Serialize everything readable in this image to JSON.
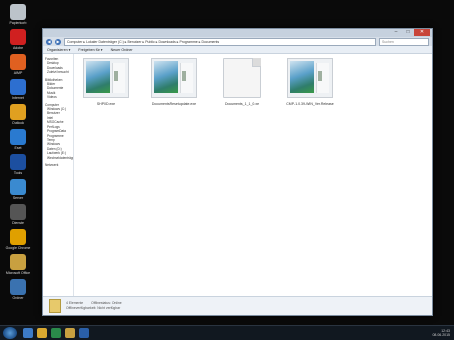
{
  "desktop": {
    "icons": [
      {
        "label": "Papierkorb",
        "color": "#bcc3ca"
      },
      {
        "label": "Adobe",
        "color": "#d02020"
      },
      {
        "label": "AIMP",
        "color": "#e06020"
      },
      {
        "label": "Internet",
        "color": "#2d6fd0"
      },
      {
        "label": "Outlook",
        "color": "#e0a020"
      },
      {
        "label": "Eset",
        "color": "#2a7ad0"
      },
      {
        "label": "Tools",
        "color": "#1c4fa0"
      },
      {
        "label": "Server",
        "color": "#3a8ad0"
      },
      {
        "label": "Dienste",
        "color": "#555555"
      },
      {
        "label": "Google Chrome",
        "color": "#e0a000"
      },
      {
        "label": "Microsoft Office",
        "color": "#c8a040"
      },
      {
        "label": "Ordner",
        "color": "#3a72b0"
      }
    ]
  },
  "window": {
    "address": "Computer ▸ Lokaler Datenträger (C:) ▸ Benutzer ▸ Public ▸ Downloads ▸ Programme ▸ Documents",
    "search_placeholder": "Suchen",
    "toolbar": {
      "organize": "Organisieren ▾",
      "share": "Freigeben für ▾",
      "new_folder": "Neuer Ordner"
    },
    "nav_items": [
      {
        "label": "Favoriten",
        "sub": false
      },
      {
        "label": "Desktop",
        "sub": true
      },
      {
        "label": "Downloads",
        "sub": true
      },
      {
        "label": "Zuletzt besucht",
        "sub": true
      },
      {
        "label": "",
        "gap": true
      },
      {
        "label": "Bibliotheken",
        "sub": false
      },
      {
        "label": "Bilder",
        "sub": true
      },
      {
        "label": "Dokumente",
        "sub": true
      },
      {
        "label": "Musik",
        "sub": true
      },
      {
        "label": "Videos",
        "sub": true
      },
      {
        "label": "",
        "gap": true
      },
      {
        "label": "Computer",
        "sub": false
      },
      {
        "label": "Windows (C:)",
        "sub": true
      },
      {
        "label": "Benutzer",
        "sub": true
      },
      {
        "label": "Intel",
        "sub": true
      },
      {
        "label": "MSOCache",
        "sub": true
      },
      {
        "label": "PerfLogs",
        "sub": true
      },
      {
        "label": "ProgramData",
        "sub": true
      },
      {
        "label": "Programme",
        "sub": true
      },
      {
        "label": "Temp",
        "sub": true
      },
      {
        "label": "Windows",
        "sub": true
      },
      {
        "label": "Daten (D:)",
        "sub": true
      },
      {
        "label": "Laufwerk (E:)",
        "sub": true
      },
      {
        "label": "Wechseldatenträger",
        "sub": true
      },
      {
        "label": "",
        "gap": true
      },
      {
        "label": "Netzwerk",
        "sub": false
      }
    ],
    "files": [
      {
        "name": "SHP0D.exe",
        "type": "image"
      },
      {
        "name": "DocumentsResetupdate.exe",
        "type": "image"
      },
      {
        "name": "Documents_1_1_0.xe",
        "type": "doc"
      },
      {
        "name": "CMP-1.0.39-WIN_Ver.Release",
        "type": "image"
      }
    ],
    "details": {
      "count": "4 Elemente",
      "offline_label": "Offlinestatus: Online",
      "availability": "Offlineverfügbarkeit: Nicht verfügbar"
    }
  },
  "taskbar": {
    "apps": [
      {
        "name": "explorer",
        "color": "#3d7bc7"
      },
      {
        "name": "chrome",
        "color": "#d8a830"
      },
      {
        "name": "media",
        "color": "#2a8a4a"
      },
      {
        "name": "folder",
        "color": "#c7a040"
      },
      {
        "name": "outlook",
        "color": "#2a5fa8"
      }
    ],
    "time": "12:43",
    "date": "08.06.2015"
  }
}
